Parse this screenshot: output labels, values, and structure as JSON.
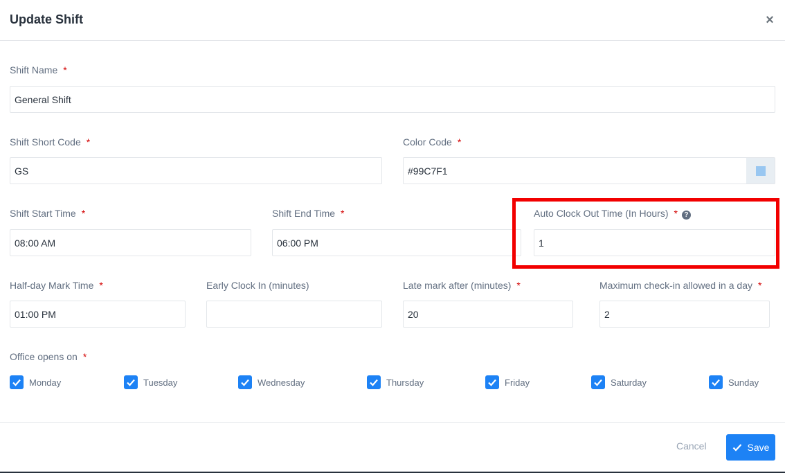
{
  "modal": {
    "title": "Update Shift",
    "close_label": "×"
  },
  "fields": {
    "shift_name": {
      "label": "Shift Name",
      "required": "*",
      "value": "General Shift"
    },
    "short_code": {
      "label": "Shift Short Code",
      "required": "*",
      "value": "GS"
    },
    "color_code": {
      "label": "Color Code",
      "required": "*",
      "value": "#99C7F1",
      "swatch_color": "#99C7F1"
    },
    "start_time": {
      "label": "Shift Start Time",
      "required": "*",
      "value": "08:00 AM"
    },
    "end_time": {
      "label": "Shift End Time",
      "required": "*",
      "value": "06:00 PM"
    },
    "auto_clock_out": {
      "label": "Auto Clock Out Time (In Hours)",
      "required": "*",
      "help_icon": "question-circle-icon",
      "value": "1"
    },
    "halfday_mark": {
      "label": "Half-day Mark Time",
      "required": "*",
      "value": "01:00 PM"
    },
    "early_clock_in": {
      "label": "Early Clock In (minutes)",
      "value": ""
    },
    "late_mark": {
      "label": "Late mark after (minutes)",
      "required": "*",
      "value": "20"
    },
    "max_checkin": {
      "label": "Maximum check-in allowed in a day",
      "required": "*",
      "value": "2"
    }
  },
  "office_days": {
    "label": "Office opens on",
    "required": "*",
    "days": [
      {
        "label": "Monday",
        "checked": true
      },
      {
        "label": "Tuesday",
        "checked": true
      },
      {
        "label": "Wednesday",
        "checked": true
      },
      {
        "label": "Thursday",
        "checked": true
      },
      {
        "label": "Friday",
        "checked": true
      },
      {
        "label": "Saturday",
        "checked": true
      },
      {
        "label": "Sunday",
        "checked": true
      }
    ]
  },
  "footer": {
    "cancel_label": "Cancel",
    "save_label": "Save"
  },
  "colors": {
    "accent": "#1D82F5",
    "highlight": "#F20000",
    "required": "#D30000"
  }
}
